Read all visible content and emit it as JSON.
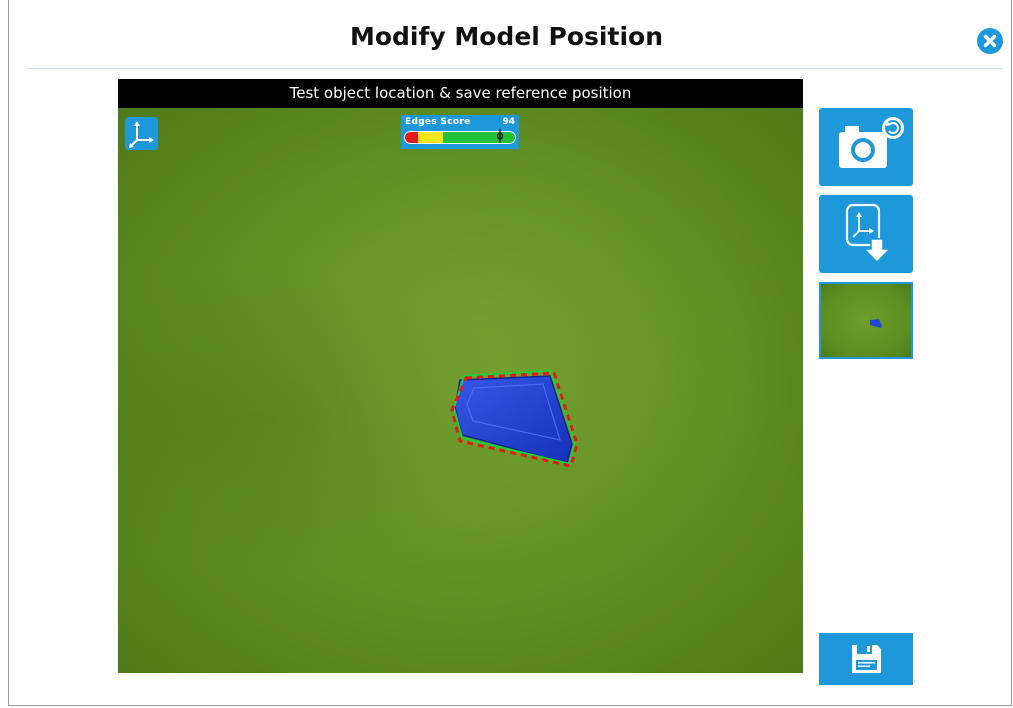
{
  "dialog": {
    "title": "Modify Model Position",
    "close_icon": "close-icon"
  },
  "camera_view": {
    "header_text": "Test object location & save reference position",
    "axis_icon": "axis-icon",
    "edges_score": {
      "label": "Edges Score",
      "value": "94",
      "fraction": 0.94,
      "colors": {
        "low": "#e11b1b",
        "mid": "#f5e61c",
        "high": "#24c13a"
      }
    }
  },
  "side_panel": {
    "snapshot_icon": "camera-refresh-icon",
    "save_reference_icon": "axis-download-icon",
    "save_icon": "floppy-disk-icon"
  },
  "colors": {
    "accent": "#1d98db",
    "header_bg": "#000000",
    "object": "#1f3fd0"
  }
}
